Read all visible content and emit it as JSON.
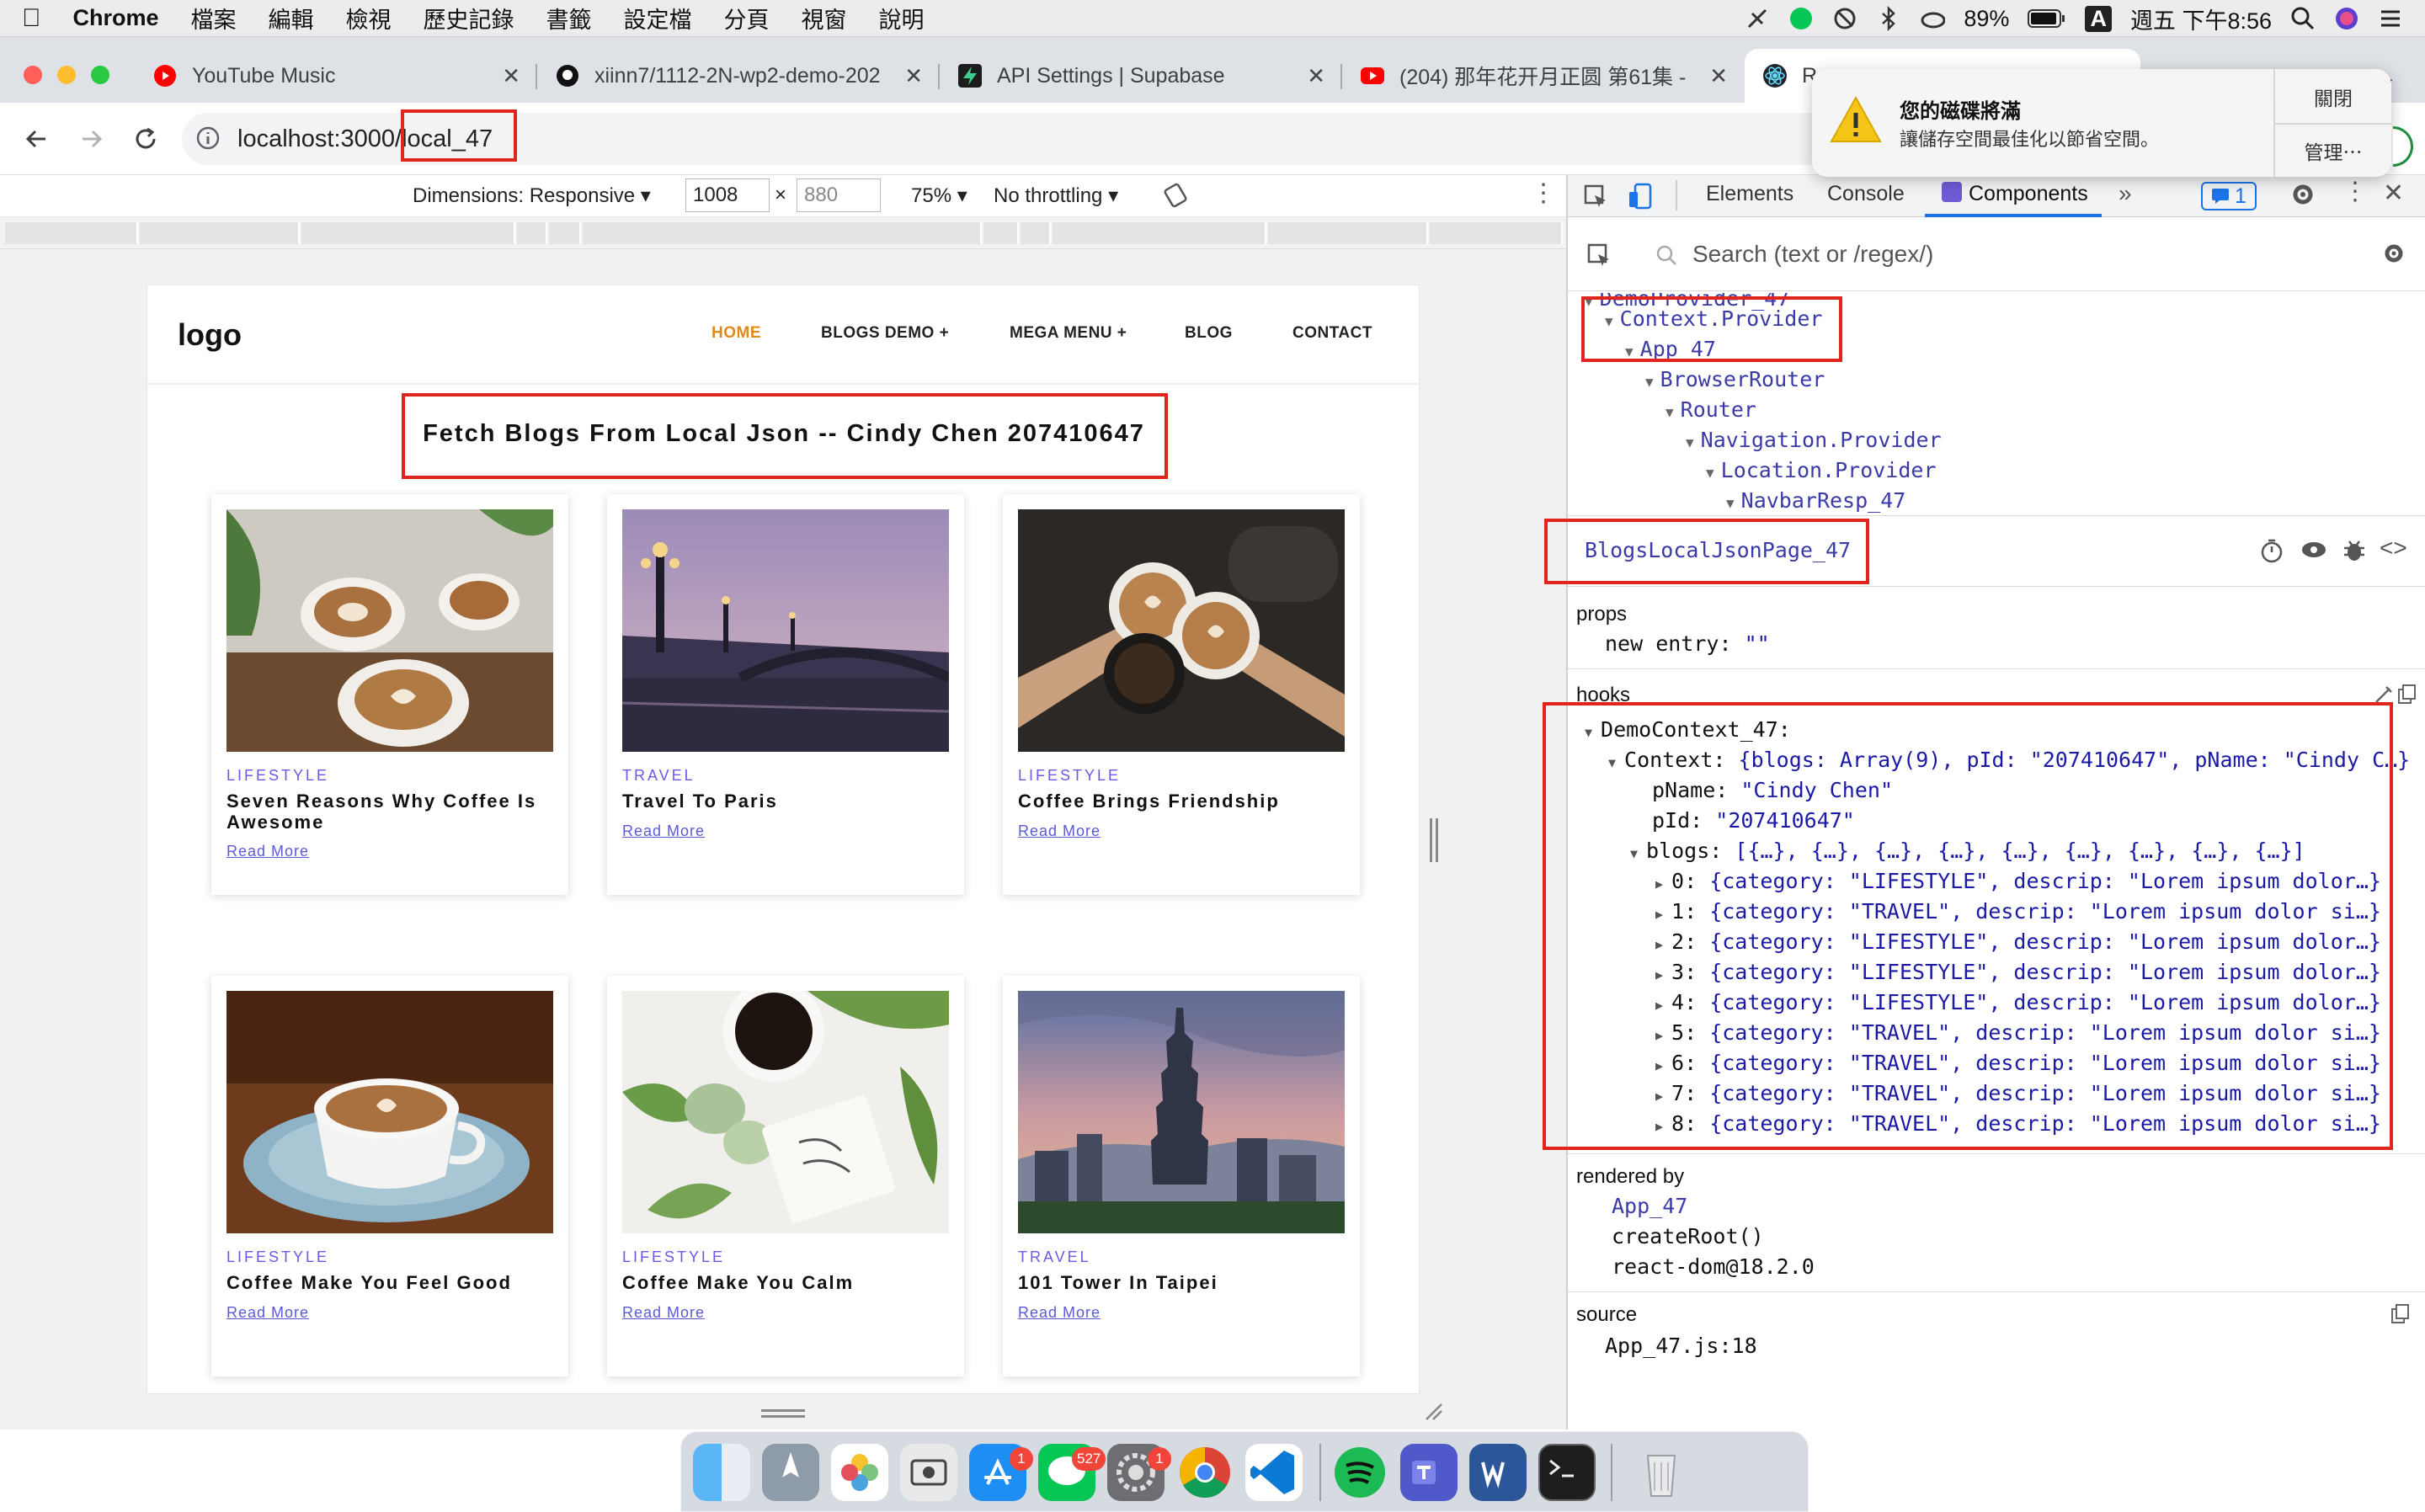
{
  "menubar": {
    "app": "Chrome",
    "items": [
      "檔案",
      "編輯",
      "檢視",
      "歷史記錄",
      "書籤",
      "設定檔",
      "分頁",
      "視窗",
      "說明"
    ],
    "battery": "89%",
    "input_method": "A",
    "clock": "週五 下午8:56"
  },
  "tabs": [
    {
      "title": "YouTube Music",
      "icon": "youtube-music-icon"
    },
    {
      "title": "xiinn7/1112-2N-wp2-demo-202",
      "icon": "github-icon"
    },
    {
      "title": "API Settings | Supabase",
      "icon": "supabase-icon"
    },
    {
      "title": "(204) 那年花开月正圆 第61集 -",
      "icon": "youtube-icon"
    },
    {
      "title": "R",
      "icon": "react-icon"
    }
  ],
  "address": {
    "host": "localhost:3000",
    "path": "/local_47"
  },
  "device_toolbar": {
    "dimensions": "Dimensions: Responsive",
    "width": "1008",
    "height": "880",
    "zoom": "75%",
    "throttling": "No throttling"
  },
  "site": {
    "logo": "logo",
    "nav": [
      "HOME",
      "BLOGS DEMO +",
      "MEGA MENU +",
      "BLOG",
      "CONTACT"
    ],
    "title": "Fetch Blogs From Local Json -- Cindy Chen 207410647",
    "read_more": "Read More",
    "cards": [
      {
        "category": "LIFESTYLE",
        "title": "Seven Reasons Why Coffee Is Awesome"
      },
      {
        "category": "TRAVEL",
        "title": "Travel To Paris"
      },
      {
        "category": "LIFESTYLE",
        "title": "Coffee Brings Friendship"
      },
      {
        "category": "LIFESTYLE",
        "title": "Coffee Make You Feel Good"
      },
      {
        "category": "LIFESTYLE",
        "title": "Coffee Make You Calm"
      },
      {
        "category": "TRAVEL",
        "title": "101 Tower In Taipei"
      }
    ]
  },
  "devtools": {
    "tabs": [
      "Elements",
      "Console",
      "Components"
    ],
    "issues_count": "1",
    "search_placeholder": "Search (text or /regex/)",
    "tree": [
      "DemoProvider_47",
      "Context.Provider",
      "App_47",
      "BrowserRouter",
      "Router",
      "Navigation.Provider",
      "Location.Provider",
      "NavbarResp_47"
    ],
    "selected": "BlogsLocalJsonPage_47",
    "props_label": "props",
    "props_line": {
      "key": "new entry:",
      "value": "\"\""
    },
    "hooks_label": "hooks",
    "hooks": {
      "context_name": "DemoContext_47:",
      "context_line": {
        "key": "Context:",
        "value": "{blogs: Array(9), pId: \"207410647\", pName: \"Cindy C…}"
      },
      "pname": {
        "key": "pName:",
        "value": "\"Cindy Chen\""
      },
      "pid": {
        "key": "pId:",
        "value": "\"207410647\""
      },
      "blogs": {
        "key": "blogs:",
        "value": "[{…}, {…}, {…}, {…}, {…}, {…}, {…}, {…}, {…}]"
      },
      "items": [
        {
          "key": "0:",
          "value": "{category: \"LIFESTYLE\", descrip: \"Lorem ipsum dolor…}"
        },
        {
          "key": "1:",
          "value": "{category: \"TRAVEL\", descrip: \"Lorem ipsum dolor si…}"
        },
        {
          "key": "2:",
          "value": "{category: \"LIFESTYLE\", descrip: \"Lorem ipsum dolor…}"
        },
        {
          "key": "3:",
          "value": "{category: \"LIFESTYLE\", descrip: \"Lorem ipsum dolor…}"
        },
        {
          "key": "4:",
          "value": "{category: \"LIFESTYLE\", descrip: \"Lorem ipsum dolor…}"
        },
        {
          "key": "5:",
          "value": "{category: \"TRAVEL\", descrip: \"Lorem ipsum dolor si…}"
        },
        {
          "key": "6:",
          "value": "{category: \"TRAVEL\", descrip: \"Lorem ipsum dolor si…}"
        },
        {
          "key": "7:",
          "value": "{category: \"TRAVEL\", descrip: \"Lorem ipsum dolor si…}"
        },
        {
          "key": "8:",
          "value": "{category: \"TRAVEL\", descrip: \"Lorem ipsum dolor si…}"
        }
      ]
    },
    "rendered_by_label": "rendered by",
    "rendered_by": [
      "App_47",
      "createRoot()",
      "react-dom@18.2.0"
    ],
    "source_label": "source",
    "source": "App_47.js:18"
  },
  "notification": {
    "title": "您的磁碟將滿",
    "body": "讓儲存空間最佳化以節省空間。",
    "close": "關閉",
    "manage": "管理⋯"
  },
  "dock": {
    "line_badge": "527",
    "appstore_badge": "1",
    "settings_badge": "1"
  },
  "colors": {
    "accent_orange": "#e08a1e",
    "category_purple": "#6a5ae8",
    "highlight_red": "#e0241e",
    "devtools_blue": "#1a73e8"
  }
}
